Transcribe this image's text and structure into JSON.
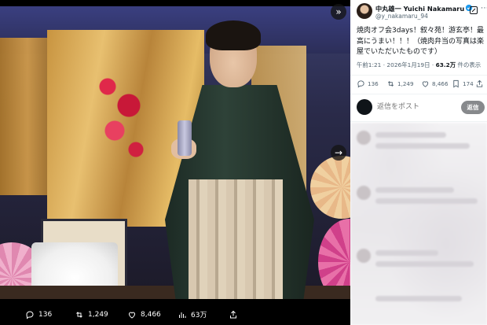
{
  "media": {
    "photo_alt": "",
    "expand_icon": "expand-chevrons-icon",
    "next_icon": "arrow-right-icon",
    "actions": {
      "replies": "136",
      "reposts": "1,249",
      "likes": "8,466",
      "views": "63万"
    }
  },
  "tweet": {
    "author_name": "中丸雄一 Yuichi Nakamaru",
    "handle": "@y_nakamaru_94",
    "text": "焼肉オフ会3days！叙々苑！游玄亭！最高にうまい！！！（焼肉弁当の写真は楽屋でいただいたものです）",
    "time": "午前1:21 · 2026年1月19日 · ",
    "views_count": "63.2万",
    "views_suffix": " 件の表示",
    "stats": {
      "replies": "136",
      "reposts": "1,249",
      "likes": "8,466",
      "bookmarks": "174"
    }
  },
  "reply": {
    "placeholder": "返信をポスト",
    "button_label": "返信"
  },
  "colors": {
    "accent": "#1d9bf0",
    "text": "#0f1419",
    "muted": "#536471",
    "reply_button": "#87898c"
  }
}
